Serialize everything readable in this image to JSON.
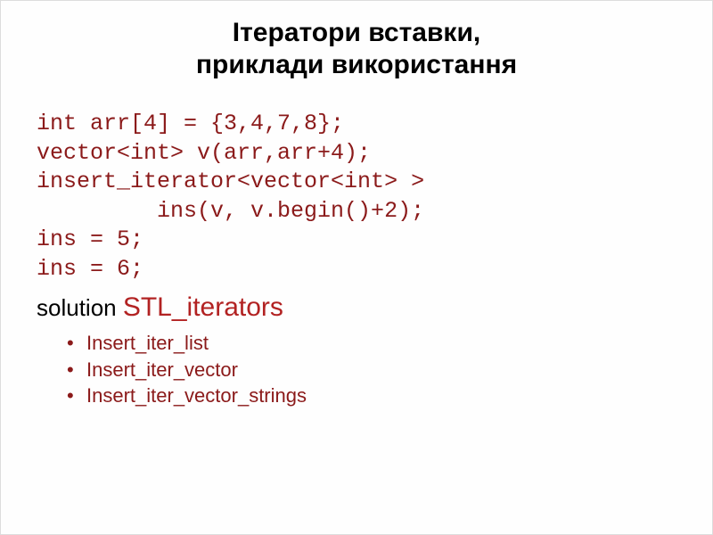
{
  "title": "Ітератори вставки,\nприклади використання",
  "code": {
    "line1": "int arr[4] = {3,4,7,8};",
    "line2": "vector<int> v(arr,arr+4);",
    "line3": "insert_iterator<vector<int> >",
    "line4": "         ins(v, v.begin()+2);",
    "line5": "ins = 5;",
    "line6": "ins = 6;"
  },
  "solution": {
    "label": "solution ",
    "highlight": "STL_iterators"
  },
  "bullets": {
    "item1": "Insert_iter_list",
    "item2": "Insert_iter_vector",
    "item3": "Insert_iter_vector_strings"
  }
}
